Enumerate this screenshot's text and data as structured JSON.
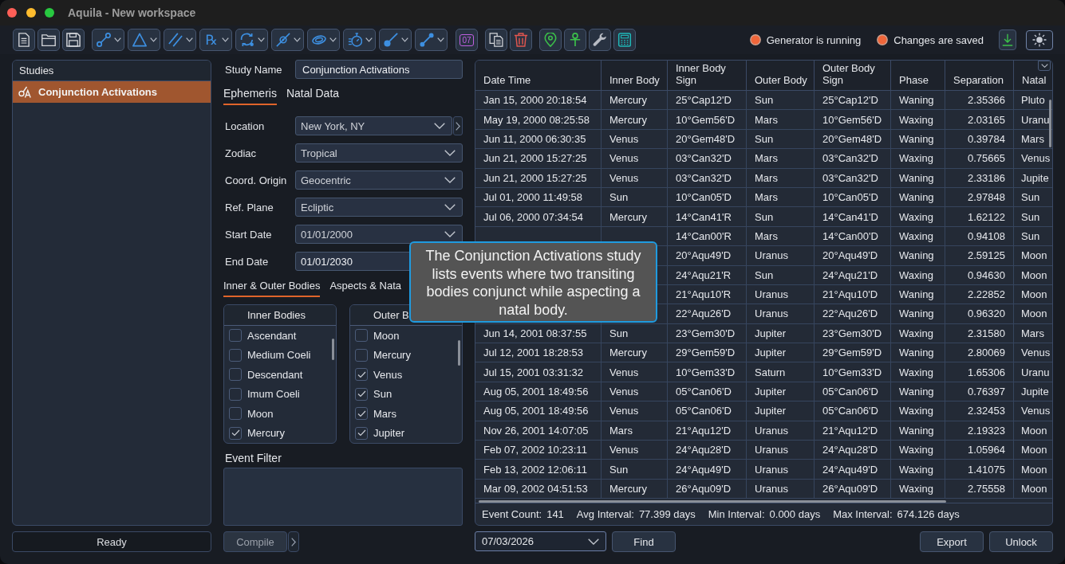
{
  "window": {
    "title": "Aquila - New workspace"
  },
  "toolbar": {
    "groups": [
      {
        "buttons": [
          {
            "kind": "icon",
            "menu": false
          },
          {
            "kind": "icon",
            "menu": false
          },
          {
            "kind": "icon",
            "menu": false
          }
        ]
      },
      {
        "buttons": [
          {
            "kind": "icon",
            "menu": true
          },
          {
            "kind": "icon",
            "menu": true
          },
          {
            "kind": "icon",
            "menu": true
          },
          {
            "kind": "glyph",
            "label": "℞",
            "menu": true
          },
          {
            "kind": "icon",
            "menu": true
          },
          {
            "kind": "icon",
            "menu": true
          },
          {
            "kind": "icon",
            "menu": true
          },
          {
            "kind": "icon",
            "menu": true
          },
          {
            "kind": "icon",
            "menu": true
          },
          {
            "kind": "icon",
            "menu": true
          }
        ]
      },
      {
        "buttons": [
          {
            "kind": "calendar",
            "label": "07",
            "menu": false
          }
        ]
      },
      {
        "buttons": [
          {
            "kind": "icon",
            "menu": false
          },
          {
            "kind": "icon",
            "menu": false
          }
        ]
      },
      {
        "buttons": [
          {
            "kind": "icon",
            "menu": false
          },
          {
            "kind": "icon",
            "menu": false
          },
          {
            "kind": "icon",
            "menu": false
          },
          {
            "kind": "icon",
            "menu": false
          }
        ]
      }
    ]
  },
  "status": [
    {
      "label": "Generator is running",
      "active": true
    },
    {
      "label": "Changes are saved",
      "active": true
    }
  ],
  "studies": {
    "title": "Studies",
    "items": [
      {
        "label": "Conjunction Activations",
        "selected": true
      }
    ]
  },
  "status_text": "Ready",
  "study": {
    "name_label": "Study Name",
    "name_value": "Conjunction Activations",
    "tabs": [
      {
        "label": "Ephemeris",
        "selected": true
      },
      {
        "label": "Natal Data",
        "selected": false
      }
    ],
    "fields": [
      {
        "label": "Location",
        "value": "New York, NY",
        "kind": "select_more"
      },
      {
        "label": "Zodiac",
        "value": "Tropical",
        "kind": "select"
      },
      {
        "label": "Coord. Origin",
        "value": "Geocentric",
        "kind": "select"
      },
      {
        "label": "Ref. Plane",
        "value": "Ecliptic",
        "kind": "select"
      },
      {
        "label": "Start Date",
        "value": "01/01/2000",
        "kind": "select"
      },
      {
        "label": "End Date",
        "value": "01/01/2030",
        "kind": "input"
      }
    ],
    "body_tabs": [
      {
        "label": "Inner & Outer Bodies",
        "selected": true
      },
      {
        "label": "Aspects & Nata",
        "selected": false
      }
    ],
    "inner_bodies": {
      "title": "Inner Bodies",
      "items": [
        {
          "label": "Ascendant",
          "checked": false
        },
        {
          "label": "Medium Coeli",
          "checked": false
        },
        {
          "label": "Descendant",
          "checked": false
        },
        {
          "label": "Imum Coeli",
          "checked": false
        },
        {
          "label": "Moon",
          "checked": false
        },
        {
          "label": "Mercury",
          "checked": true
        }
      ]
    },
    "outer_bodies": {
      "title": "Outer B",
      "items": [
        {
          "label": "Moon",
          "checked": false
        },
        {
          "label": "Mercury",
          "checked": false
        },
        {
          "label": "Venus",
          "checked": true
        },
        {
          "label": "Sun",
          "checked": true
        },
        {
          "label": "Mars",
          "checked": true
        },
        {
          "label": "Jupiter",
          "checked": true
        }
      ]
    },
    "event_filter": {
      "label": "Event Filter"
    },
    "compile": {
      "label": "Compile",
      "disabled": true
    }
  },
  "events": {
    "columns": [
      "Date Time",
      "Inner Body",
      "Inner Body Sign",
      "Outer Body",
      "Outer Body Sign",
      "Phase",
      "Separation",
      "Natal"
    ],
    "rows": [
      [
        "Jan 15, 2000 20:18:54",
        "Mercury",
        "25°Cap12'D",
        "Sun",
        "25°Cap12'D",
        "Waning",
        "2.35366",
        "Pluto"
      ],
      [
        "May 19, 2000 08:25:58",
        "Mercury",
        "10°Gem56'D",
        "Mars",
        "10°Gem56'D",
        "Waxing",
        "2.03165",
        "Uranu"
      ],
      [
        "Jun 11, 2000 06:30:35",
        "Venus",
        "20°Gem48'D",
        "Sun",
        "20°Gem48'D",
        "Waning",
        "0.39784",
        "Mars"
      ],
      [
        "Jun 21, 2000 15:27:25",
        "Venus",
        "03°Can32'D",
        "Mars",
        "03°Can32'D",
        "Waxing",
        "0.75665",
        "Venus"
      ],
      [
        "Jun 21, 2000 15:27:25",
        "Venus",
        "03°Can32'D",
        "Mars",
        "03°Can32'D",
        "Waning",
        "2.33186",
        "Jupite"
      ],
      [
        "Jul 01, 2000 11:49:58",
        "Sun",
        "10°Can05'D",
        "Mars",
        "10°Can05'D",
        "Waning",
        "2.97848",
        "Sun"
      ],
      [
        "Jul 06, 2000 07:34:54",
        "Mercury",
        "14°Can41'R",
        "Sun",
        "14°Can41'D",
        "Waxing",
        "1.62122",
        "Sun"
      ],
      [
        null,
        null,
        "14°Can00'R",
        "Mars",
        "14°Can00'D",
        "Waxing",
        "0.94108",
        "Sun"
      ],
      [
        null,
        null,
        "20°Aqu49'D",
        "Uranus",
        "20°Aqu49'D",
        "Waning",
        "2.59125",
        "Moon"
      ],
      [
        null,
        null,
        "24°Aqu21'R",
        "Sun",
        "24°Aqu21'D",
        "Waxing",
        "0.94630",
        "Moon"
      ],
      [
        null,
        null,
        "21°Aqu10'R",
        "Uranus",
        "21°Aqu10'D",
        "Waning",
        "2.22852",
        "Moon"
      ],
      [
        null,
        null,
        "22°Aqu26'D",
        "Uranus",
        "22°Aqu26'D",
        "Waning",
        "0.96320",
        "Moon"
      ],
      [
        "Jun 14, 2001 08:37:55",
        "Sun",
        "23°Gem30'D",
        "Jupiter",
        "23°Gem30'D",
        "Waxing",
        "2.31580",
        "Mars"
      ],
      [
        "Jul 12, 2001 18:28:53",
        "Mercury",
        "29°Gem59'D",
        "Jupiter",
        "29°Gem59'D",
        "Waning",
        "2.80069",
        "Venus"
      ],
      [
        "Jul 15, 2001 03:31:32",
        "Venus",
        "10°Gem33'D",
        "Saturn",
        "10°Gem33'D",
        "Waxing",
        "1.65306",
        "Uranu"
      ],
      [
        "Aug 05, 2001 18:49:56",
        "Venus",
        "05°Can06'D",
        "Jupiter",
        "05°Can06'D",
        "Waning",
        "0.76397",
        "Jupite"
      ],
      [
        "Aug 05, 2001 18:49:56",
        "Venus",
        "05°Can06'D",
        "Jupiter",
        "05°Can06'D",
        "Waxing",
        "2.32453",
        "Venus"
      ],
      [
        "Nov 26, 2001 14:07:05",
        "Mars",
        "21°Aqu12'D",
        "Uranus",
        "21°Aqu12'D",
        "Waning",
        "2.19323",
        "Moon"
      ],
      [
        "Feb 07, 2002 10:23:11",
        "Venus",
        "24°Aqu28'D",
        "Uranus",
        "24°Aqu28'D",
        "Waxing",
        "1.05964",
        "Moon"
      ],
      [
        "Feb 13, 2002 12:06:11",
        "Sun",
        "24°Aqu49'D",
        "Uranus",
        "24°Aqu49'D",
        "Waxing",
        "1.41075",
        "Moon"
      ],
      [
        "Mar 09, 2002 04:51:53",
        "Mercury",
        "26°Aqu09'D",
        "Uranus",
        "26°Aqu09'D",
        "Waxing",
        "2.75558",
        "Moon"
      ]
    ],
    "stats": [
      {
        "label": "Event Count:",
        "value": "141"
      },
      {
        "label": "Avg Interval:",
        "value": "77.399 days"
      },
      {
        "label": "Min Interval:",
        "value": "0.000 days"
      },
      {
        "label": "Max Interval:",
        "value": "674.126 days"
      }
    ]
  },
  "date_picker": {
    "value": "07/03/2026"
  },
  "find_button": "Find",
  "actions": [
    "Export",
    "Unlock"
  ],
  "tooltip": {
    "text": "The Conjunction Activations study lists events where two transiting bodies conjunct while aspecting a natal body."
  }
}
